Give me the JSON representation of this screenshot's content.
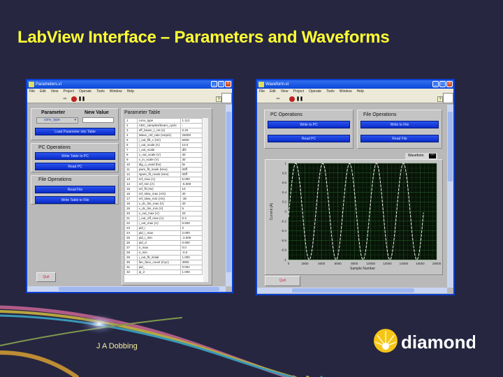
{
  "slide": {
    "title": "LabView Interface – Parameters and Waveforms",
    "author": "J A Dobbing",
    "logo_text": "diamond",
    "colors": {
      "background": "#262641",
      "title": "#ffff33",
      "button": "#1a3fe0",
      "plot_bg": "#0a1a0a"
    }
  },
  "params_window": {
    "title": "Parameters.vi",
    "menu": [
      "File",
      "Edit",
      "View",
      "Project",
      "Operate",
      "Tools",
      "Window",
      "Help"
    ],
    "param_label": "Parameter",
    "new_value_label": "New Value",
    "param_select": "conv_type",
    "new_value": "",
    "load_button": "Load Parameter into Table",
    "pc_ops_label": "PC Operations",
    "write_pc": "Write Table to PC",
    "read_pc": "Read PC",
    "file_ops_label": "File Operations",
    "read_file": "Read File",
    "write_file": "Write Table to File",
    "quit": "Quit",
    "table_title": "Parameter Table",
    "rows": [
      [
        "1",
        "conv_type",
        "1.112"
      ],
      [
        "2",
        "ADC_samples/beam_cycle",
        "-"
      ],
      [
        "3",
        "eff_beam_t_cnt (s)",
        "0.20"
      ],
      [
        "4",
        "Wave_ctrl_rate (smp/s)",
        "25000"
      ],
      [
        "5",
        "i_out_filt_c (Hz)",
        "5000"
      ],
      [
        "6",
        "i_out_scale (A)",
        "10.0"
      ],
      [
        "7",
        "i_out_scale",
        "dhl"
      ],
      [
        "8",
        "v_out_scale (V)",
        "30"
      ],
      [
        "9",
        "v_in_scale (V)",
        "30"
      ],
      [
        "10",
        "dig_o_avail (bx)",
        "fw"
      ],
      [
        "11",
        "pwm_flt_mask (Hex)",
        "00ff"
      ],
      [
        "12",
        "spare_flt_mask (Hex)",
        "00ff"
      ],
      [
        "13",
        "ref_max (A)",
        "5.000"
      ],
      [
        "14",
        "ref_min (A)",
        "-5.000"
      ],
      [
        "15",
        "ref_flt (Hz)",
        "10"
      ],
      [
        "16",
        "ref_slew_max (A/s)",
        "30"
      ],
      [
        "17",
        "ref_slew_min (A/s)",
        "-30"
      ],
      [
        "18",
        "v_dc_lim_max (V)",
        "30"
      ],
      [
        "19",
        "v_dc_lim_min (V)",
        "5"
      ],
      [
        "20",
        "v_out_max (V)",
        "20"
      ],
      [
        "21",
        "i_out_off_max (A)",
        "0.3"
      ],
      [
        "22",
        "i_out_max (A)",
        "5.500"
      ],
      [
        "23",
        "pid_i",
        "2"
      ],
      [
        "24",
        "pid_i_max",
        "2.000"
      ],
      [
        "25",
        "pid_i_min",
        "-2.000"
      ],
      [
        "26",
        "pid_d",
        "0.000"
      ],
      [
        "27",
        "ir_max",
        "0.0"
      ],
      [
        "28",
        "ir_min",
        "-0.0"
      ],
      [
        "29",
        "i_out_flt_initial",
        "1.000"
      ],
      [
        "30",
        "fan_face_count (/cyc)",
        "3000"
      ],
      [
        "31",
        "pid_",
        "0.001"
      ],
      [
        "32",
        "ip_2",
        "1.000"
      ]
    ]
  },
  "wave_window": {
    "title": "Waveform.vi",
    "menu": [
      "File",
      "Edit",
      "View",
      "Project",
      "Operate",
      "Tools",
      "Window",
      "Help"
    ],
    "pc_ops_label": "PC Operations",
    "write_pc": "Write to PC",
    "read_pc": "Read PC",
    "file_ops_label": "File Operations",
    "write_file": "Write to File",
    "read_file": "Read File",
    "legend": "Waveform",
    "quit": "Quit"
  },
  "chart_data": {
    "type": "line",
    "title": "",
    "legend": [
      "Waveform"
    ],
    "legend_placement": "top-right",
    "xlabel": "Sample Number",
    "ylabel": "Current (A)",
    "xlim": [
      0,
      18000
    ],
    "ylim": [
      -1,
      1
    ],
    "xticks": [
      "0",
      "2000",
      "4000",
      "6000",
      "8000",
      "10000",
      "12000",
      "14000",
      "16000",
      "18000"
    ],
    "yticks": [
      "1",
      "0.8",
      "0.6",
      "0.4",
      "0.2",
      "0",
      "-0.2",
      "-0.4",
      "-0.6",
      "-0.8",
      "-1"
    ],
    "grid": true,
    "series": [
      {
        "name": "Waveform",
        "function": "sine",
        "amplitude": 1,
        "period_samples": 3270,
        "phase_offset_samples": 62,
        "x_end": 16400
      }
    ]
  }
}
